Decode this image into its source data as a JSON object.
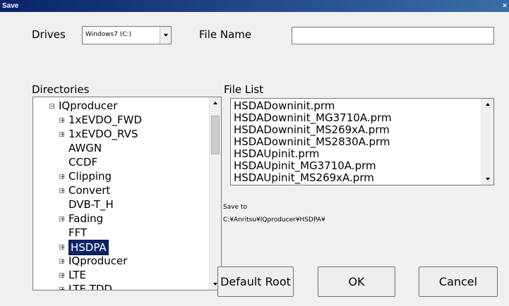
{
  "window": {
    "title": "Save",
    "close_glyph": "×"
  },
  "drives": {
    "label": "Drives",
    "selected": "Windows7 (C:)"
  },
  "file_name": {
    "label": "File Name",
    "value": ""
  },
  "directories": {
    "label": "Directories",
    "items": [
      {
        "label": "IQproducer",
        "level": 0,
        "expander": "⊟"
      },
      {
        "label": "1xEVDO_FWD",
        "level": 1,
        "expander": "⊞"
      },
      {
        "label": "1xEVDO_RVS",
        "level": 1,
        "expander": "⊞"
      },
      {
        "label": "AWGN",
        "level": 1,
        "expander": ""
      },
      {
        "label": "CCDF",
        "level": 1,
        "expander": ""
      },
      {
        "label": "Clipping",
        "level": 1,
        "expander": "⊞"
      },
      {
        "label": "Convert",
        "level": 1,
        "expander": "⊞"
      },
      {
        "label": "DVB-T_H",
        "level": 1,
        "expander": ""
      },
      {
        "label": "Fading",
        "level": 1,
        "expander": "⊞"
      },
      {
        "label": "FFT",
        "level": 1,
        "expander": ""
      },
      {
        "label": "HSDPA",
        "level": 1,
        "expander": "⊞",
        "selected": true
      },
      {
        "label": "IQproducer",
        "level": 1,
        "expander": "⊞"
      },
      {
        "label": "LTE",
        "level": 1,
        "expander": "⊞"
      },
      {
        "label": "LTE TDD",
        "level": 1,
        "expander": "⊞"
      }
    ]
  },
  "file_list": {
    "label": "File List",
    "items": [
      "HSDADowninit.prm",
      "HSDADowninit_MG3710A.prm",
      "HSDADowninit_MS269xA.prm",
      "HSDADowninit_MS2830A.prm",
      "HSDAUpinit.prm",
      "HSDAUpinit_MG3710A.prm",
      "HSDAUpinit_MS269xA.prm"
    ]
  },
  "save_to": {
    "label": "Save to",
    "path": "C:¥Anritsu¥IQproducer¥HSDPA¥"
  },
  "buttons": {
    "default_root": "Default Root",
    "ok": "OK",
    "cancel": "Cancel"
  }
}
